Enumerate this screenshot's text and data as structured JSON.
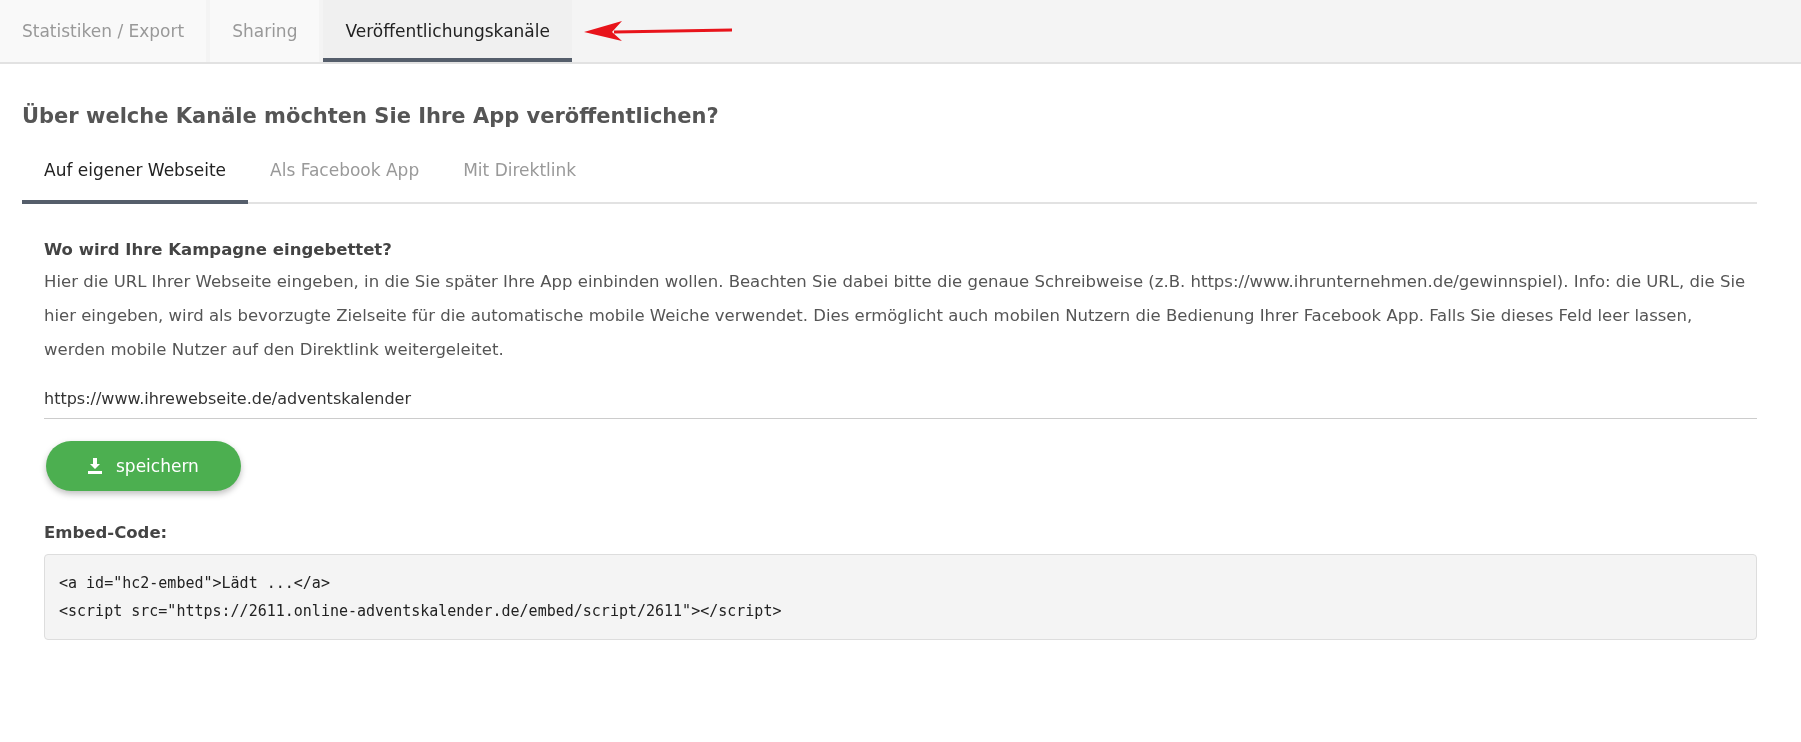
{
  "top_tabs": [
    {
      "label": "Statistiken / Export",
      "selected": false
    },
    {
      "label": "Sharing",
      "selected": false
    },
    {
      "label": "Veröffentlichungskanäle",
      "selected": true
    }
  ],
  "heading": "Über welche Kanäle möchten Sie Ihre App veröffentlichen?",
  "channel_tabs": [
    {
      "label": "Auf eigener Webseite",
      "selected": true
    },
    {
      "label": "Als Facebook App",
      "selected": false
    },
    {
      "label": "Mit Direktlink",
      "selected": false
    }
  ],
  "section_title": "Wo wird Ihre Kampagne eingebettet?",
  "description": "Hier die URL Ihrer Webseite eingeben, in die Sie später Ihre App einbinden wollen. Beachten Sie dabei bitte die genaue Schreibweise (z.B. https://www.ihrunternehmen.de/gewinnspiel). Info: die URL, die Sie hier eingeben, wird als bevorzugte Zielseite für die automatische mobile Weiche verwendet. Dies ermöglicht auch mobilen Nutzern die Bedienung Ihrer Facebook App. Falls Sie dieses Feld leer lassen, werden mobile Nutzer auf den Direktlink weitergeleitet.",
  "url_field": {
    "value": "https://www.ihrewebseite.de/adventskalender"
  },
  "save_button": "speichern",
  "embed_label": "Embed-Code:",
  "embed_code": [
    "<a id=\"hc2-embed\">Lädt ...</a>",
    "<script src=\"https://2611.online-adventskalender.de/embed/script/2611\"></script>"
  ]
}
